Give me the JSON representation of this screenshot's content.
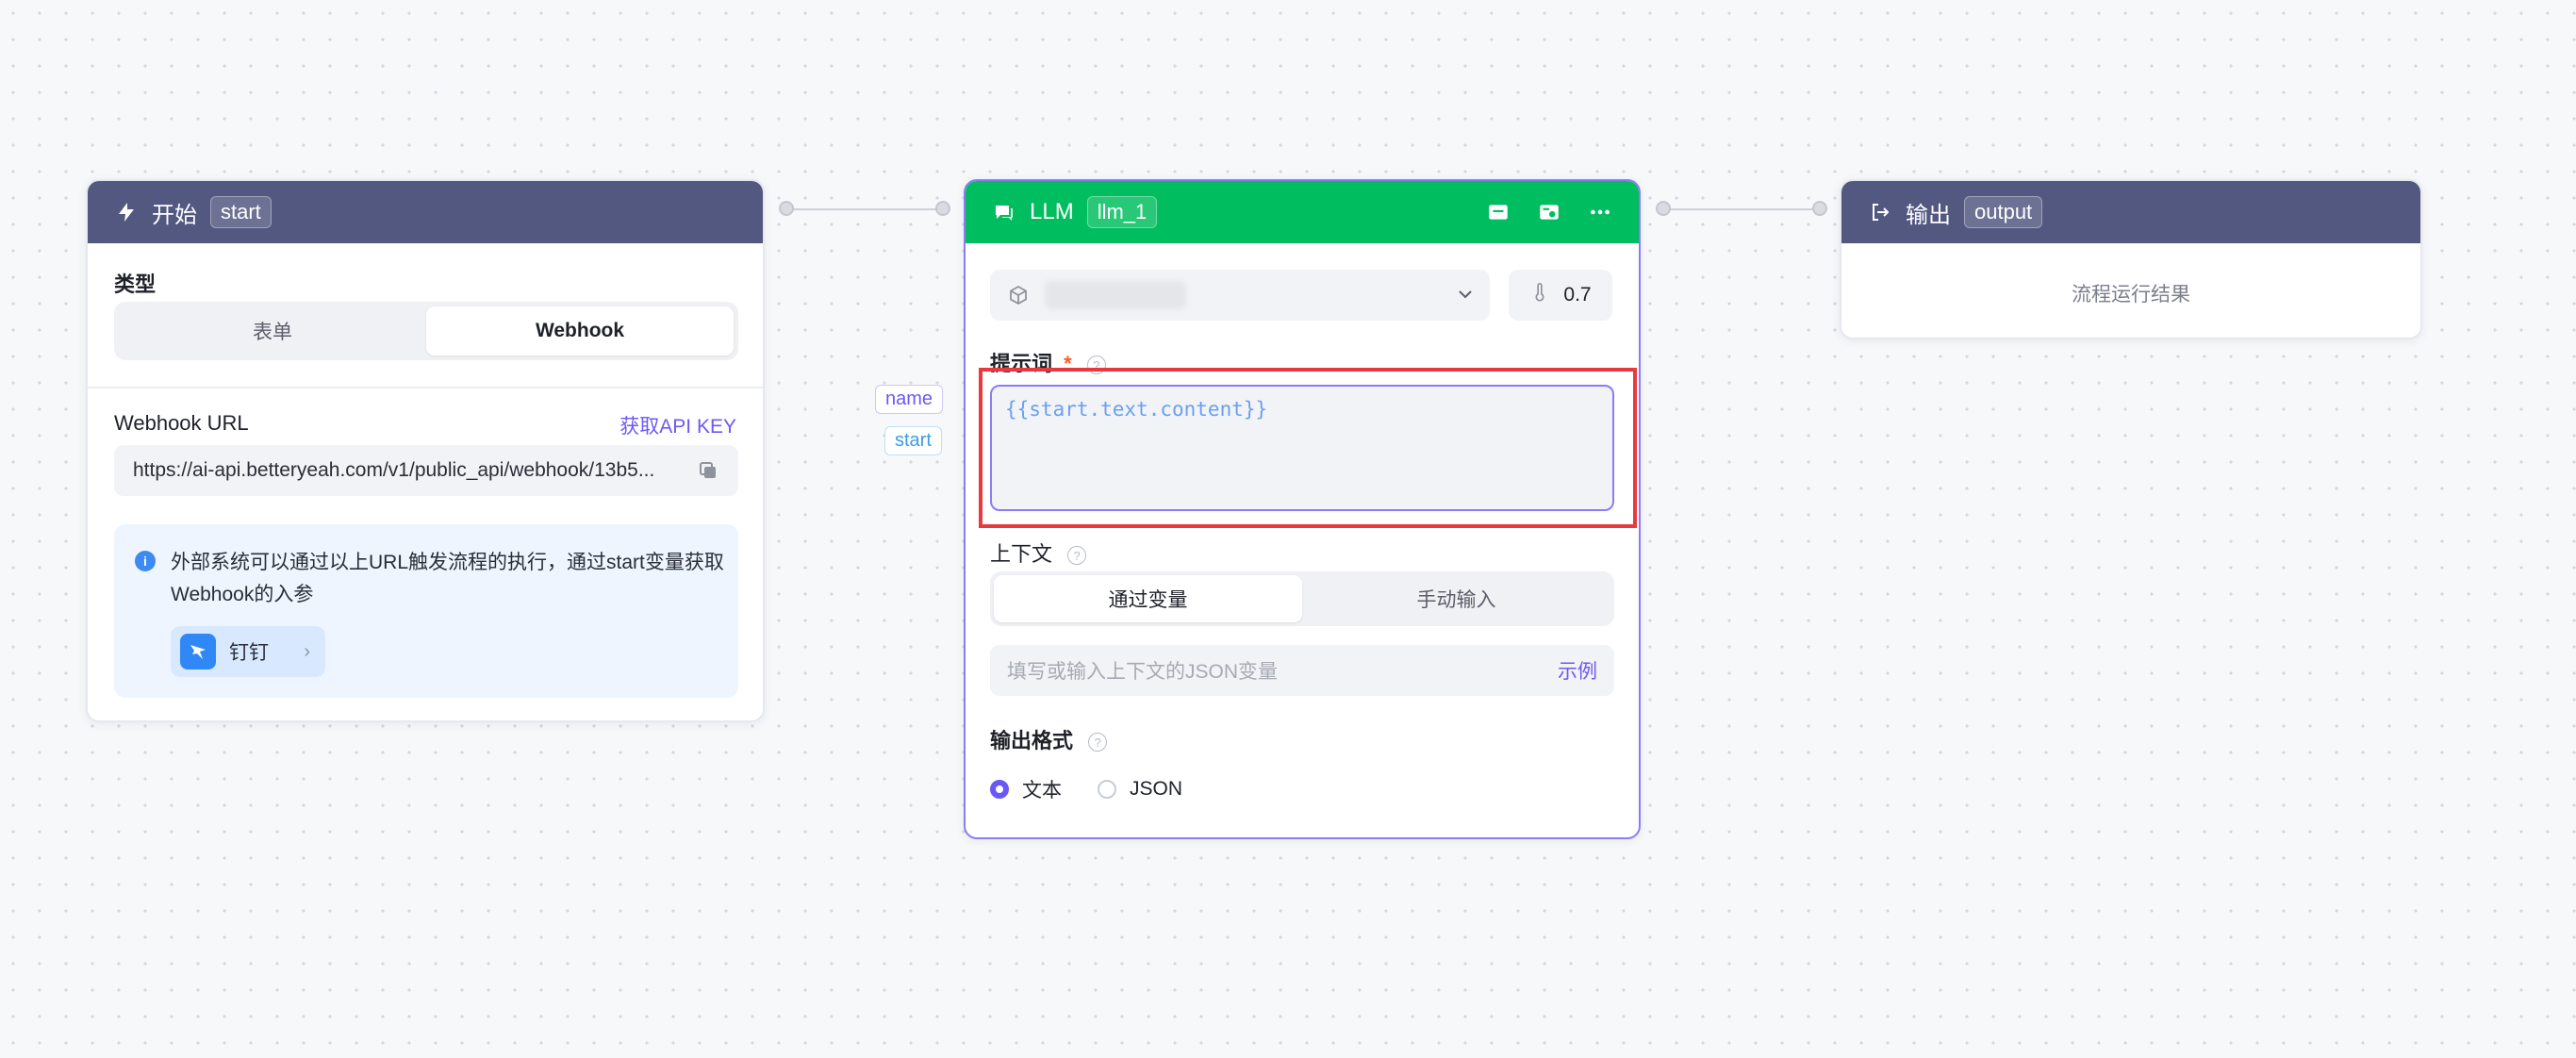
{
  "start_node": {
    "title": "开始",
    "tag": "start",
    "type_label": "类型",
    "type_options": [
      "表单",
      "Webhook"
    ],
    "type_selected": "Webhook",
    "webhook_label": "Webhook URL",
    "api_key_link": "获取API KEY",
    "webhook_url": "https://ai-api.betteryeah.com/v1/public_api/webhook/13b5...",
    "info_text_1": "外部系统可以通过以上URL触发流程的执行，通过start变量获取",
    "info_text_2": "Webhook的入参",
    "integration_label": "钉钉"
  },
  "variables": {
    "name_tag": "name",
    "start_tag": "start"
  },
  "llm_node": {
    "title": "LLM",
    "tag": "llm_1",
    "temperature": "0.7",
    "prompt_label": "提示词",
    "required_mark": "*",
    "prompt_text": "{{start.text.content}}",
    "context_label": "上下文",
    "context_options": [
      "通过变量",
      "手动输入"
    ],
    "context_selected": "通过变量",
    "context_placeholder": "填写或输入上下文的JSON变量",
    "example_link": "示例",
    "output_format_label": "输出格式",
    "output_formats": [
      "文本",
      "JSON"
    ],
    "output_format_selected": "文本"
  },
  "output_node": {
    "title": "输出",
    "tag": "output",
    "result_text": "流程运行结果"
  },
  "colors": {
    "header_dark": "#525880",
    "header_green": "#00be5f",
    "accent": "#6b59f5",
    "highlight": "#e8393f"
  }
}
